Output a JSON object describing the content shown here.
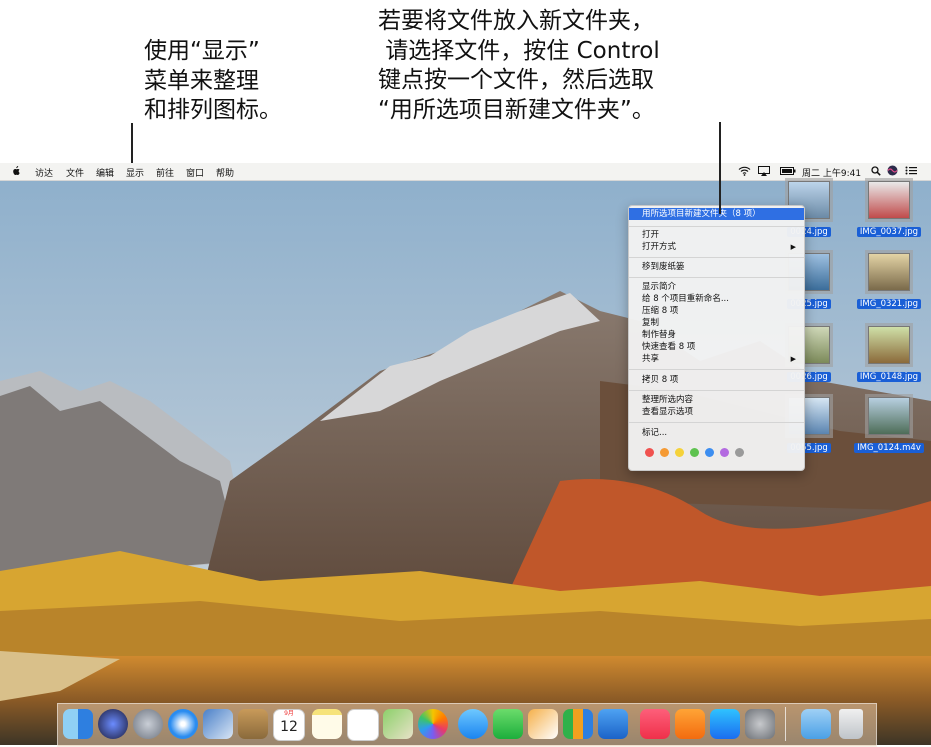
{
  "callouts": {
    "left": [
      "使用“显示”",
      "菜单来整理",
      "和排列图标。"
    ],
    "right": [
      "若要将文件放入新文件夹，",
      " 请选择文件，按住 Control",
      "键点按一个文件，然后选取",
      "“用所选项目新建文件夹”。"
    ]
  },
  "menubar": {
    "items": [
      "访达",
      "文件",
      "编辑",
      "显示",
      "前往",
      "窗口",
      "帮助"
    ],
    "clock": "周二 上午9:41",
    "status_icons": [
      "wifi-icon",
      "airplay-icon",
      "battery-icon",
      "spotlight-icon",
      "siri-icon",
      "notification-center-icon"
    ]
  },
  "files": [
    {
      "label": "0024.jpg"
    },
    {
      "label": "IMG_0037.jpg"
    },
    {
      "label": "0025.jpg"
    },
    {
      "label": "IMG_0321.jpg"
    },
    {
      "label": "0026.jpg"
    },
    {
      "label": "IMG_0148.jpg"
    },
    {
      "label": "0055.jpg"
    },
    {
      "label": "IMG_0124.m4v"
    }
  ],
  "context_menu": {
    "items": [
      {
        "label": "用所选项目新建文件夹（8 项）",
        "highlighted": true
      },
      {
        "label": "打开"
      },
      {
        "label": "打开方式",
        "submenu": true
      },
      {
        "label": "移到废纸篓"
      },
      {
        "label": "显示简介"
      },
      {
        "label": "给 8 个项目重新命名..."
      },
      {
        "label": "压缩 8 项"
      },
      {
        "label": "复制"
      },
      {
        "label": "制作替身"
      },
      {
        "label": "快速查看 8 项"
      },
      {
        "label": "共享",
        "submenu": true
      },
      {
        "label": "拷贝 8 项"
      },
      {
        "label": "整理所选内容"
      },
      {
        "label": "查看显示选项"
      },
      {
        "label": "标记..."
      }
    ],
    "tag_colors": [
      "#f0524f",
      "#f59a33",
      "#f5d23a",
      "#5ec24f",
      "#3d8ef0",
      "#b36ae0",
      "#9a9a9a"
    ]
  },
  "dock": {
    "calendar_month": "9月",
    "calendar_day": "12",
    "apps": [
      "finder-icon",
      "siri-icon",
      "launchpad-icon",
      "safari-icon",
      "photo-booth-icon",
      "contacts-icon",
      "calendar-icon",
      "notes-icon",
      "reminders-icon",
      "maps-icon",
      "photos-icon",
      "messages-icon",
      "facetime-icon",
      "pages-icon",
      "numbers-icon",
      "keynote-icon",
      "music-icon",
      "books-icon",
      "app-store-icon",
      "system-preferences-icon",
      "downloads-folder-icon",
      "trash-icon"
    ]
  }
}
